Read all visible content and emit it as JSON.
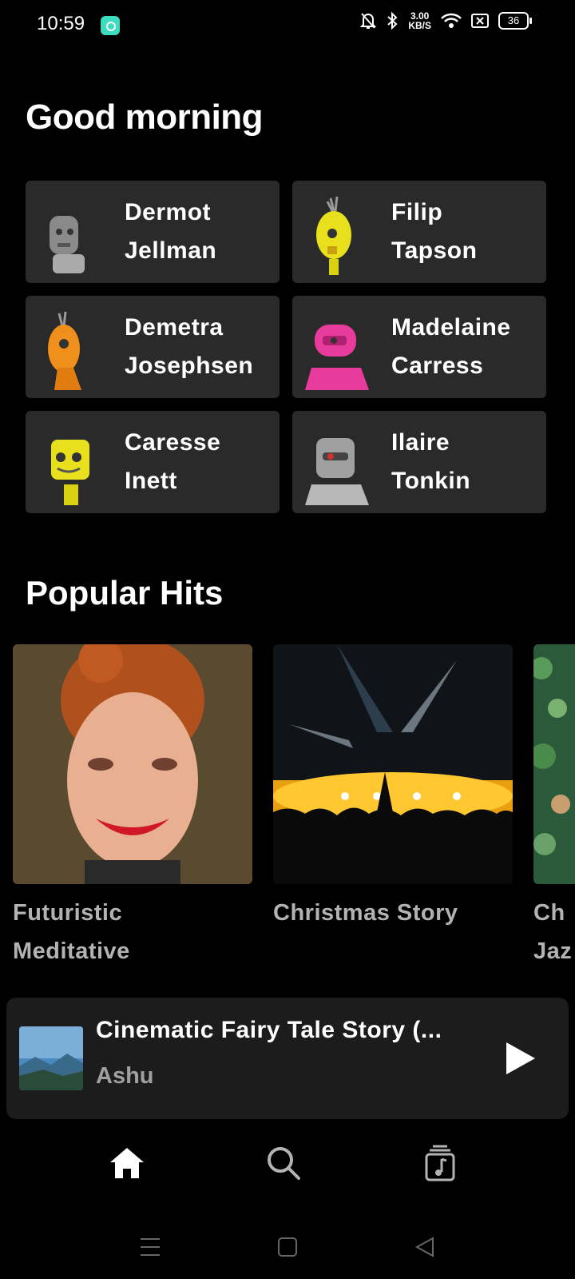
{
  "status": {
    "time": "10:59",
    "speed_value": "3.00",
    "speed_unit": "KB/S",
    "battery": "36"
  },
  "greeting": "Good morning",
  "quick_picks": [
    {
      "line1": "Dermot",
      "line2": "Jellman",
      "color": "#8a8a8a"
    },
    {
      "line1": "Filip",
      "line2": "Tapson",
      "color": "#e8e01c"
    },
    {
      "line1": "Demetra",
      "line2": "Josephsen",
      "color": "#f0901c"
    },
    {
      "line1": "Madelaine",
      "line2": "Carress",
      "color": "#e83c9c"
    },
    {
      "line1": "Caresse",
      "line2": "Inett",
      "color": "#e8e01c"
    },
    {
      "line1": "Ilaire",
      "line2": "Tonkin",
      "color": "#a0a0a0"
    }
  ],
  "section_title": "Popular Hits",
  "popular": [
    {
      "line1": "Futuristic",
      "line2": "Meditative"
    },
    {
      "line1": "Christmas Story",
      "line2": ""
    },
    {
      "line1": "Ch",
      "line2": "Jaz"
    }
  ],
  "now_playing": {
    "title": "Cinematic Fairy Tale Story (...",
    "artist": "Ashu"
  },
  "tabs": [
    "home-icon",
    "search-icon",
    "library-icon"
  ],
  "colors": {
    "card_bg": "#2a2a2a",
    "player_bg": "#1c1c1c",
    "muted_text": "#b3b3b3"
  }
}
